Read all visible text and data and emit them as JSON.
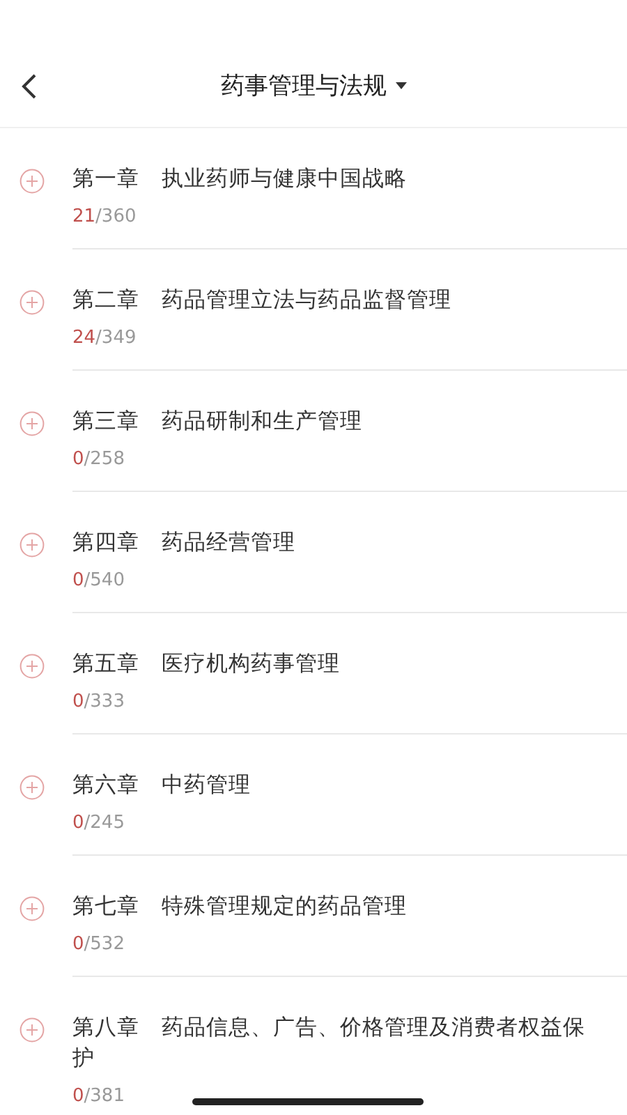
{
  "header": {
    "title": "药事管理与法规"
  },
  "chapters": [
    {
      "title": "第一章　执业药师与健康中国战略",
      "done": "21",
      "total": "/360"
    },
    {
      "title": "第二章　药品管理立法与药品监督管理",
      "done": "24",
      "total": "/349"
    },
    {
      "title": "第三章　药品研制和生产管理",
      "done": "0",
      "total": "/258"
    },
    {
      "title": "第四章　药品经营管理",
      "done": "0",
      "total": "/540"
    },
    {
      "title": "第五章　医疗机构药事管理",
      "done": "0",
      "total": "/333"
    },
    {
      "title": "第六章　中药管理",
      "done": "0",
      "total": "/245"
    },
    {
      "title": "第七章　特殊管理规定的药品管理",
      "done": "0",
      "total": "/532"
    },
    {
      "title": "第八章　药品信息、广告、价格管理及消费者权益保护",
      "done": "0",
      "total": "/381"
    }
  ]
}
